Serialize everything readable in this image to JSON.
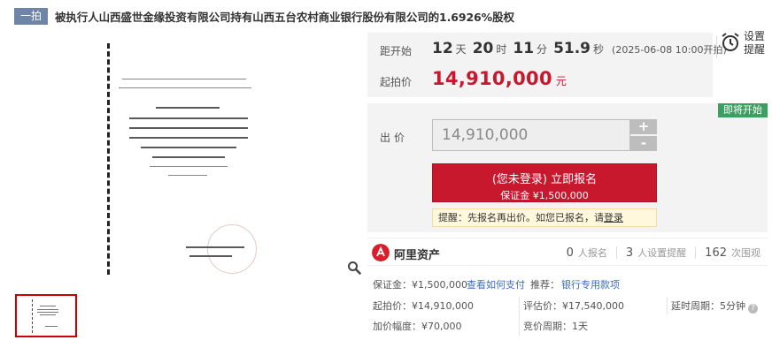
{
  "title": {
    "tag": "一拍",
    "text": "被执行人山西盛世金缘投资有限公司持有山西五台农村商业银行股份有限公司的1.6926%股权"
  },
  "countdown": {
    "label": "距开始",
    "days": "12",
    "days_unit": "天",
    "hours": "20",
    "hours_unit": "时",
    "minutes": "11",
    "minutes_unit": "分",
    "seconds": "51.9",
    "seconds_unit": "秒",
    "start_time": "(2025-06-08 10:00开拍)"
  },
  "start_price": {
    "label": "起拍价",
    "value": "14,910,000",
    "unit": "元"
  },
  "remind": {
    "line1": "设置",
    "line2": "提醒"
  },
  "bid": {
    "tag": "即将开始",
    "label": "出价",
    "input_value": "14,910,000",
    "plus": "+",
    "minus": "-",
    "signup_main": "(您未登录) 立即报名",
    "signup_sub": "保证金 ¥1,500,000",
    "tip_prefix": "提醒：先报名再出价。如您已报名，请",
    "tip_link": "登录"
  },
  "org": {
    "name": "阿里资产",
    "stats": [
      {
        "num": "0",
        "label": "人报名"
      },
      {
        "num": "3",
        "label": "人设置提醒"
      },
      {
        "num": "162",
        "label": "次围观"
      }
    ]
  },
  "meta": {
    "deposit": "保证金：¥1,500,000",
    "how_to_pay": "查看如何支付",
    "recommend_label": "推荐：",
    "recommend_link": "银行专用款项",
    "start_price": "起拍价：¥14,910,000",
    "assess_price": "评估价：¥17,540,000",
    "delay": "延时周期：5分钟",
    "increment": "加价幅度：¥70,000",
    "cycle": "竞价周期：1天"
  },
  "colors": {
    "accent": "#c7182d",
    "tag_blue": "#6e85a8",
    "green_tag": "#3d9e61",
    "link": "#3b6cc7"
  },
  "icons": {
    "zoom": "magnifier-icon",
    "remind": "alarm-clock-icon",
    "logo": "ali-assets-logo-icon",
    "help": "question-icon"
  }
}
